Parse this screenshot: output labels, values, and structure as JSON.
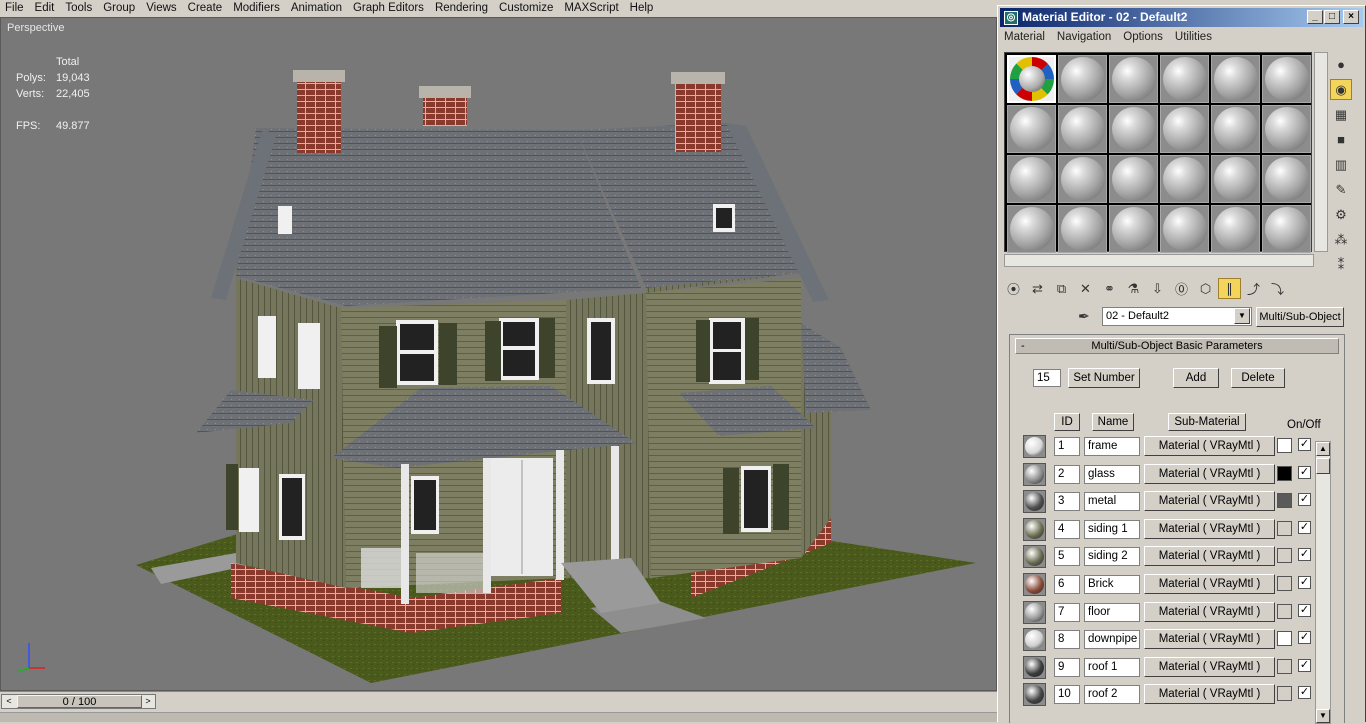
{
  "menubar": [
    "File",
    "Edit",
    "Tools",
    "Group",
    "Views",
    "Create",
    "Modifiers",
    "Animation",
    "Graph Editors",
    "Rendering",
    "Customize",
    "MAXScript",
    "Help"
  ],
  "viewport": {
    "label": "Perspective",
    "stats": {
      "header": "Total",
      "polys_label": "Polys:",
      "polys": "19,043",
      "verts_label": "Verts:",
      "verts": "22,405",
      "fps_label": "FPS:",
      "fps": "49.877"
    }
  },
  "timeline": {
    "frame": "0 / 100",
    "prev": "<",
    "next": ">"
  },
  "material_editor": {
    "title": "Material Editor - 02 - Default2",
    "menu": [
      "Material",
      "Navigation",
      "Options",
      "Utilities"
    ],
    "material_name": "02 - Default2",
    "material_type": "Multi/Sub-Object",
    "rollout": {
      "title": "Multi/Sub-Object Basic Parameters",
      "collapse": "-",
      "set_number_value": "15",
      "set_number": "Set Number",
      "add": "Add",
      "delete": "Delete",
      "col_id": "ID",
      "col_name": "Name",
      "col_sub": "Sub-Material",
      "col_onoff": "On/Off"
    },
    "submaterials": [
      {
        "id": "1",
        "name": "frame",
        "mat": "Material  ( VRayMtl )",
        "color": "#ffffff",
        "sphere": "#d8d8d8"
      },
      {
        "id": "2",
        "name": "glass",
        "mat": "Material  ( VRayMtl )",
        "color": "#000000",
        "sphere": "#8c8c8c"
      },
      {
        "id": "3",
        "name": "metal",
        "mat": "Material  ( VRayMtl )",
        "color": "#5a5a5a",
        "sphere": "#505050"
      },
      {
        "id": "4",
        "name": "siding 1",
        "mat": "Material  ( VRayMtl )",
        "color": "#d4d0c8",
        "sphere": "#6e6f52"
      },
      {
        "id": "5",
        "name": "siding 2",
        "mat": "Material  ( VRayMtl )",
        "color": "#d4d0c8",
        "sphere": "#6a6b50"
      },
      {
        "id": "6",
        "name": "Brick",
        "mat": "Material  ( VRayMtl )",
        "color": "#d4d0c8",
        "sphere": "#8a4c3a"
      },
      {
        "id": "7",
        "name": "floor",
        "mat": "Material  ( VRayMtl )",
        "color": "#d4d0c8",
        "sphere": "#9a9a9a"
      },
      {
        "id": "8",
        "name": "downpipe",
        "mat": "Material  ( VRayMtl )",
        "color": "#ffffff",
        "sphere": "#d0d0d0"
      },
      {
        "id": "9",
        "name": "roof 1",
        "mat": "Material  ( VRayMtl )",
        "color": "#d4d0c8",
        "sphere": "#3c3c3c"
      },
      {
        "id": "10",
        "name": "roof 2",
        "mat": "Material  ( VRayMtl )",
        "color": "#d4d0c8",
        "sphere": "#444444"
      }
    ]
  }
}
